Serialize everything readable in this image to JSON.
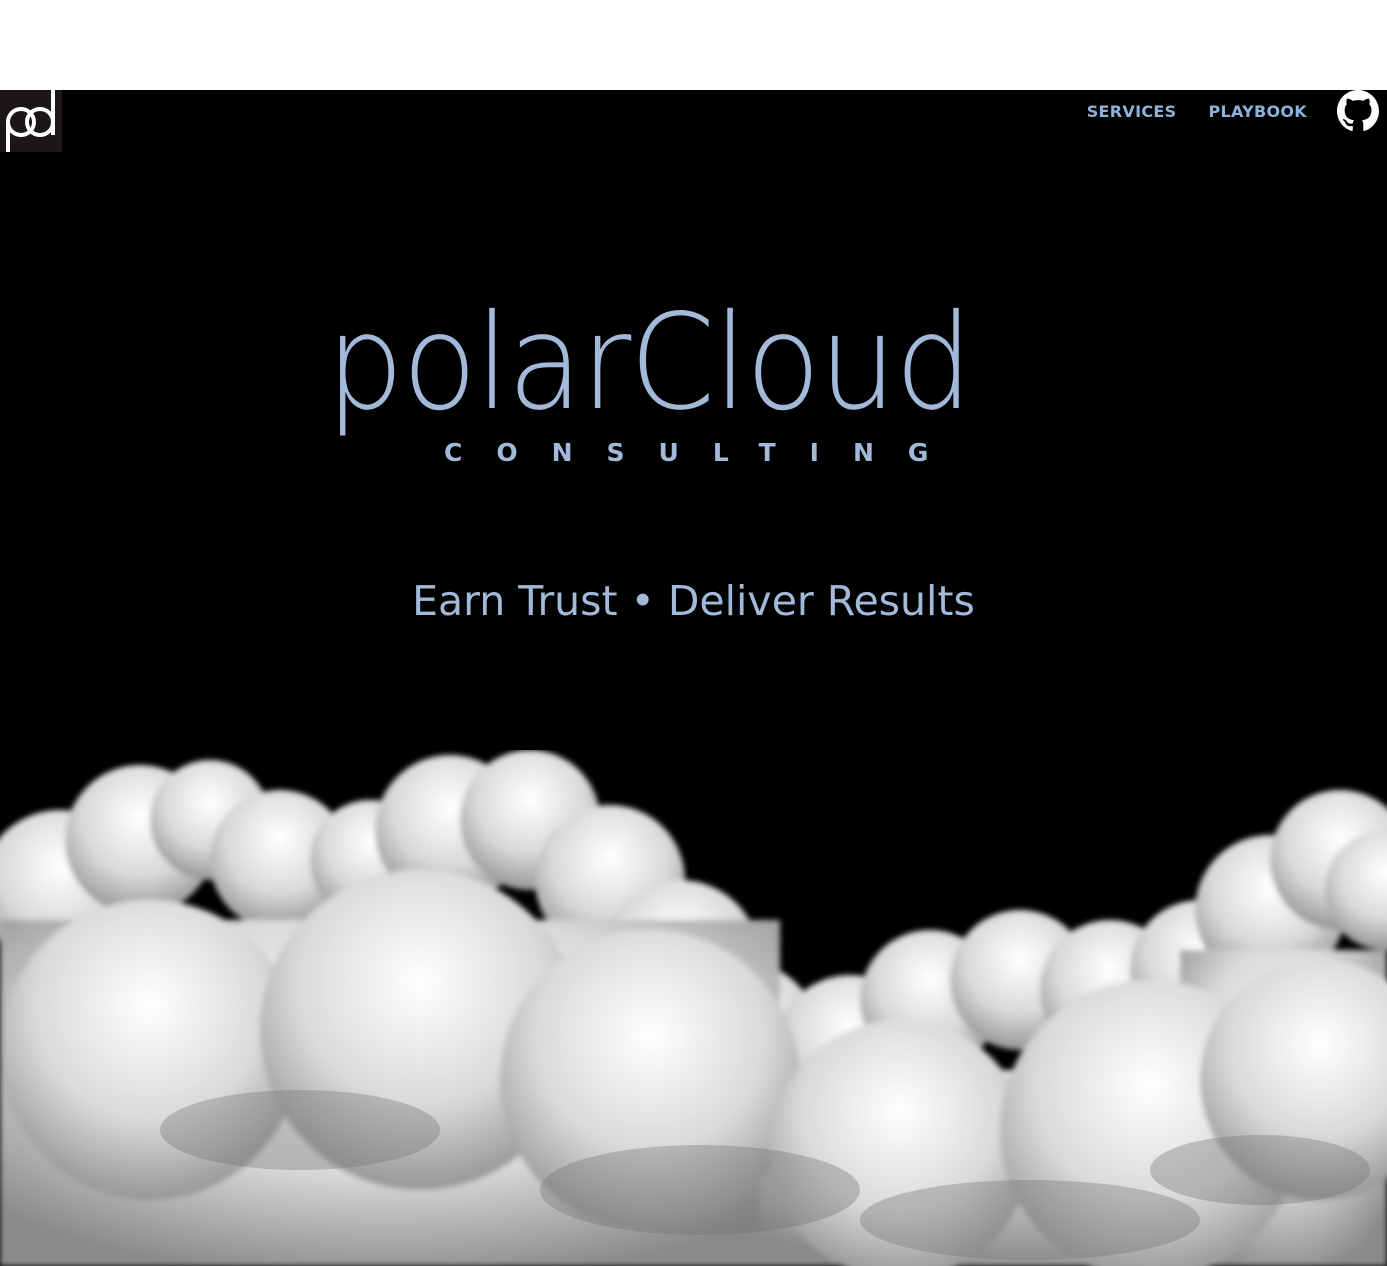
{
  "nav": {
    "items": [
      {
        "label": "SERVICES"
      },
      {
        "label": "PLAYBOOK"
      }
    ],
    "github_icon": "github-icon"
  },
  "logo": {
    "mark_text": "pd",
    "icon": "pd-monogram-icon"
  },
  "brand": {
    "name": "polarCloud",
    "subtitle": "CONSULTING"
  },
  "hero": {
    "tagline": "Earn Trust • Deliver Results",
    "background": "clouds-image"
  },
  "colors": {
    "accent": "#a3b9da",
    "nav": "#8fb2dc",
    "background": "#000000"
  }
}
